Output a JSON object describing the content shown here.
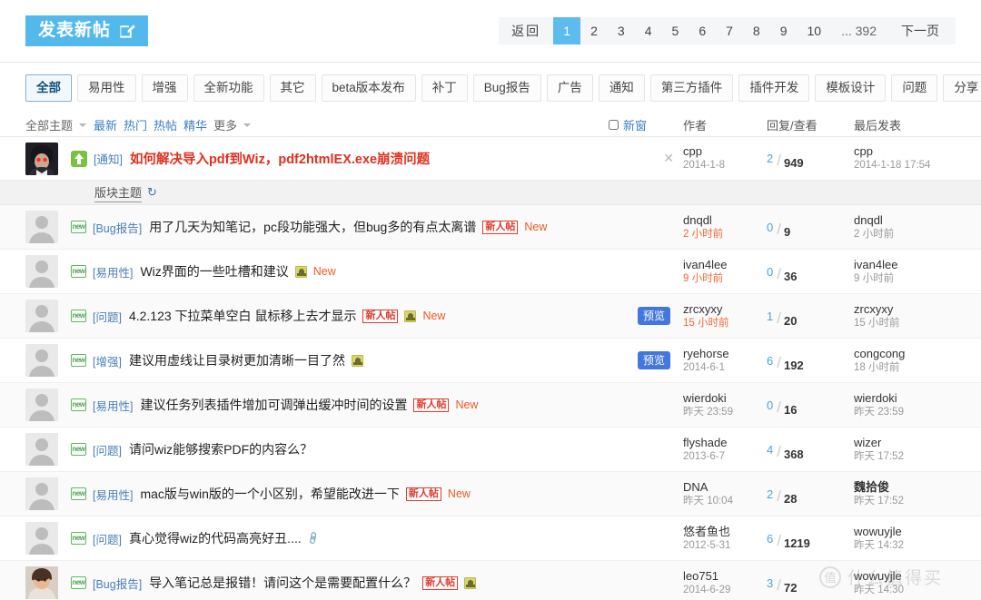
{
  "topbar": {
    "new_post_label": "发表新帖",
    "new_post_icon": "pencil-square-icon",
    "pagination": {
      "back_label": "返回",
      "pages": [
        "1",
        "2",
        "3",
        "4",
        "5",
        "6",
        "7",
        "8",
        "9",
        "10"
      ],
      "current": "1",
      "ellipsis_last": "... 392",
      "next_label": "下一页"
    }
  },
  "categories": {
    "active": "全部",
    "items": [
      "全部",
      "易用性",
      "增强",
      "全新功能",
      "其它",
      "beta版本发布",
      "补丁",
      "Bug报告",
      "广告",
      "通知",
      "第三方插件",
      "插件开发",
      "模板设计",
      "问题",
      "分享"
    ]
  },
  "filterbar": {
    "all_topics": "全部主题",
    "sorts": [
      "最新",
      "热门",
      "热帖",
      "精华"
    ],
    "more": "更多",
    "new_window": "新窗",
    "col_author": "作者",
    "col_reply_view": "回复/查看",
    "col_last_post": "最后发表"
  },
  "section": {
    "title": "版块主题",
    "refresh_icon": "refresh-icon"
  },
  "sticky": {
    "icon": "sticky-up-icon",
    "category": "[通知]",
    "title": "如何解决导入pdf到Wiz，pdf2htmlEX.exe崩溃问题",
    "close_icon": "close-icon",
    "author": "cpp",
    "author_date": "2014-1-8",
    "replies": "2",
    "views": "949",
    "last_author": "cpp",
    "last_date": "2014-1-18 17:54"
  },
  "threads": [
    {
      "avatar": "generic",
      "icon": "new-post-icon",
      "category": "[Bug报告]",
      "title": "用了几天为知笔记，pc段功能强大，但bug多的有点太离谱",
      "badge_newbie": "新人帖",
      "badge_image": false,
      "badge_attach": false,
      "new_label": "New",
      "preview": null,
      "author": "dnqdl",
      "author_date": "2 小时前",
      "author_date_hot": true,
      "replies": "0",
      "views": "9",
      "last_author": "dnqdl",
      "last_date": "2 小时前"
    },
    {
      "avatar": "generic",
      "icon": "new-post-icon",
      "category": "[易用性]",
      "title": "Wiz界面的一些吐槽和建议",
      "badge_newbie": null,
      "badge_image": true,
      "badge_attach": false,
      "new_label": "New",
      "preview": null,
      "author": "ivan4lee",
      "author_date": "9 小时前",
      "author_date_hot": true,
      "replies": "0",
      "views": "36",
      "last_author": "ivan4lee",
      "last_date": "9 小时前"
    },
    {
      "avatar": "generic",
      "icon": "new-post-icon",
      "category": "[问题]",
      "title": "4.2.123 下拉菜单空白 鼠标移上去才显示",
      "badge_newbie": "新人帖",
      "badge_image": true,
      "badge_attach": false,
      "new_label": "New",
      "preview": "预览",
      "author": "zrcxyxy",
      "author_date": "15 小时前",
      "author_date_hot": true,
      "replies": "1",
      "views": "20",
      "last_author": "zrcxyxy",
      "last_date": "15 小时前"
    },
    {
      "avatar": "generic",
      "icon": "new-post-icon",
      "category": "[增强]",
      "title": "建议用虚线让目录树更加清晰一目了然",
      "badge_newbie": null,
      "badge_image": true,
      "badge_attach": false,
      "new_label": null,
      "preview": "预览",
      "author": "ryehorse",
      "author_date": "2014-6-1",
      "author_date_hot": false,
      "replies": "6",
      "views": "192",
      "last_author": "congcong",
      "last_date": "18 小时前"
    },
    {
      "avatar": "generic",
      "icon": "new-post-icon",
      "category": "[易用性]",
      "title": "建议任务列表插件增加可调弹出缓冲时间的设置",
      "badge_newbie": "新人帖",
      "badge_image": false,
      "badge_attach": false,
      "new_label": "New",
      "preview": null,
      "author": "wierdoki",
      "author_date": "昨天 23:59",
      "author_date_hot": false,
      "replies": "0",
      "views": "16",
      "last_author": "wierdoki",
      "last_date": "昨天 23:59"
    },
    {
      "avatar": "generic",
      "icon": "new-post-icon",
      "category": "[问题]",
      "title": "请问wiz能够搜索PDF的内容么？",
      "badge_newbie": null,
      "badge_image": false,
      "badge_attach": false,
      "new_label": null,
      "preview": null,
      "author": "flyshade",
      "author_date": "2013-6-7",
      "author_date_hot": false,
      "replies": "4",
      "views": "368",
      "last_author": "wizer",
      "last_date": "昨天 17:52"
    },
    {
      "avatar": "generic",
      "icon": "new-post-icon",
      "category": "[易用性]",
      "title": "mac版与win版的一个小区别，希望能改进一下",
      "badge_newbie": "新人帖",
      "badge_image": false,
      "badge_attach": false,
      "new_label": "New",
      "preview": null,
      "author": "DNA",
      "author_date": "昨天 10:04",
      "author_date_hot": false,
      "replies": "2",
      "views": "28",
      "last_author": "魏拾俊",
      "last_author_bold": true,
      "last_date": "昨天 17:52"
    },
    {
      "avatar": "generic",
      "icon": "new-post-icon",
      "category": "[问题]",
      "title": "真心觉得wiz的代码高亮好丑....",
      "badge_newbie": null,
      "badge_image": false,
      "badge_attach": true,
      "new_label": null,
      "preview": null,
      "author": "悠者鱼也",
      "author_date": "2012-5-31",
      "author_date_hot": false,
      "replies": "6",
      "views": "1219",
      "last_author": "wowuyjle",
      "last_date": "昨天 14:32"
    },
    {
      "avatar": "photo",
      "icon": "new-post-icon",
      "category": "[Bug报告]",
      "title": "导入笔记总是报错！请问这个是需要配置什么？",
      "badge_newbie": "新人帖",
      "badge_image": true,
      "badge_attach": false,
      "new_label": null,
      "preview": null,
      "author": "leo751",
      "author_date": "2014-6-29",
      "author_date_hot": false,
      "replies": "3",
      "views": "72",
      "last_author": "wowuyjle",
      "last_date": "昨天 14:30"
    }
  ],
  "watermark": {
    "mark": "值",
    "text": "什么值得买"
  },
  "colors": {
    "accent": "#53b9ec",
    "pager_current": "#5cbcee",
    "link": "#4a7ebb",
    "hot_date": "#ee6a3a",
    "newbie_badge": "#e03a2f",
    "sticky_title": "#e0301e",
    "preview_button": "#4477dd"
  }
}
